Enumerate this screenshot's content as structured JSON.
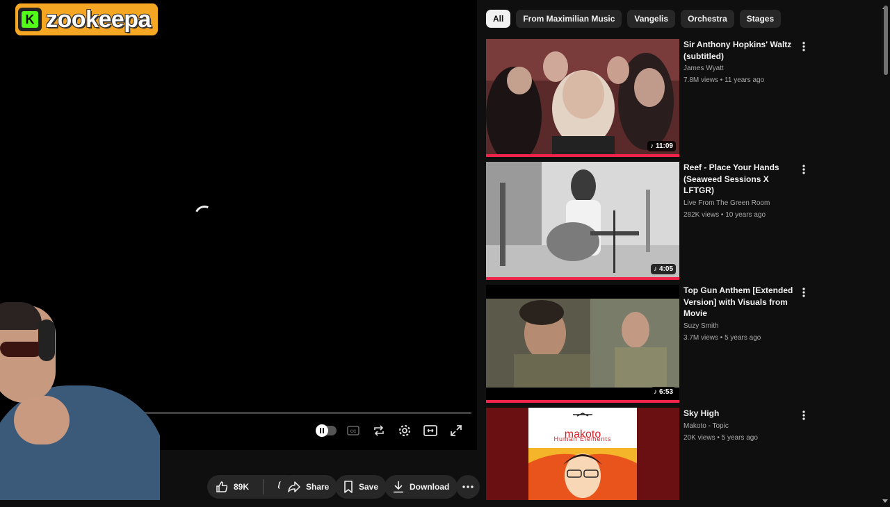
{
  "overlay": {
    "logo_text": "zookeepa",
    "logo_letter": "K"
  },
  "player": {
    "controls": [
      "autoplay-toggle",
      "captions-icon",
      "loop-icon",
      "settings-icon",
      "theater-icon",
      "fullscreen-icon"
    ]
  },
  "actions": {
    "like_count": "89K",
    "share_label": "Share",
    "save_label": "Save",
    "download_label": "Download"
  },
  "chips": [
    "All",
    "From Maximilian Music",
    "Vangelis",
    "Orchestra",
    "Stages"
  ],
  "recommendations": [
    {
      "title": "Sir Anthony Hopkins' Waltz (subtitled)",
      "channel": "James Wyatt",
      "stats": "7.8M views • 11 years ago",
      "duration": "11:09"
    },
    {
      "title": "Reef - Place Your Hands (Seaweed Sessions X LFTGR)",
      "channel": "Live From The Green Room",
      "stats": "282K views • 10 years ago",
      "duration": "4:05"
    },
    {
      "title": "Top Gun Anthem [Extended Version] with Visuals from Movie",
      "channel": "Suzy Smith",
      "stats": "3.7M views • 5 years ago",
      "duration": "6:53"
    },
    {
      "title": "Sky High",
      "channel": "Makoto - Topic",
      "stats": "20K views • 5 years ago",
      "duration": ""
    }
  ],
  "album_art": {
    "artist": "makoto",
    "album": "Human Elements"
  },
  "colors": {
    "accent_red": "#f0234a",
    "bg": "#0f0f0f",
    "chip_bg": "#272727",
    "logo_orange": "#f5a623",
    "kick_green": "#53fc18"
  }
}
